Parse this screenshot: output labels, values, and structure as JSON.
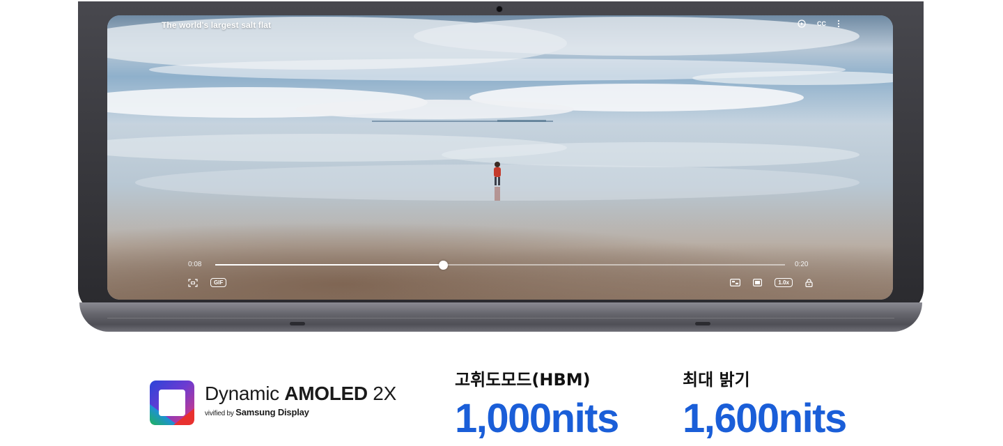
{
  "video": {
    "title": "The world's largest salt flat",
    "current_time": "0:08",
    "duration": "0:20",
    "progress": 0.4,
    "cc_label": "CC",
    "gif_label": "GIF",
    "speed_label": "1.0x",
    "icons": [
      "play-circle-icon",
      "more-vertical-icon",
      "screenshot-capture-icon",
      "pip-icon",
      "popup-view-icon",
      "lock-icon"
    ]
  },
  "display": {
    "brand_light": "Dynamic ",
    "brand_bold": "AMOLED",
    "brand_suffix": " 2X",
    "vivified": "vivified",
    "by": " by ",
    "samsung_display": "Samsung Display"
  },
  "specs": [
    {
      "label": "고휘도모드(HBM)",
      "value": "1,000nits"
    },
    {
      "label": "최대 밝기",
      "value": "1,600nits"
    }
  ],
  "colors": {
    "accent": "#1a5ed8",
    "text": "#111111"
  }
}
